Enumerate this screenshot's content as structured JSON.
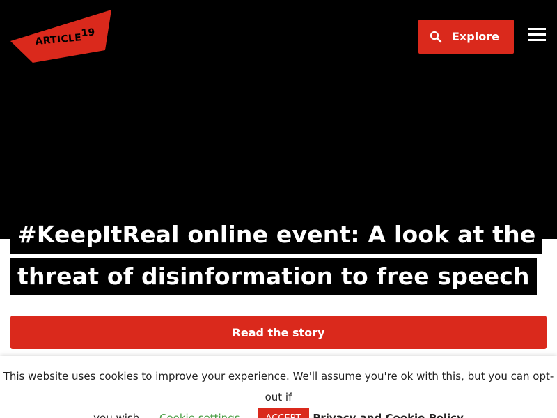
{
  "header": {
    "logo_text": "ARTICLE",
    "logo_superscript": "19",
    "explore_label": "Explore",
    "search_icon": "search-icon",
    "menu_icon": "hamburger-menu-icon"
  },
  "hero": {
    "headline": "#KeepItReal online event: A look at the threat of disinformation to free speech",
    "cta_label": "Read the story"
  },
  "cookie_banner": {
    "message_part1": "This website uses cookies to improve your experience. We'll assume you're ok with this, but you can opt-out if",
    "message_part2": "you wish.",
    "settings_label": "Cookie settings",
    "accept_label": "ACCEPT",
    "policy_label": "Privacy and Cookie Policy"
  },
  "colors": {
    "accent": "#da291c",
    "hero_bg": "#000000",
    "link_green": "#4a9e45"
  }
}
